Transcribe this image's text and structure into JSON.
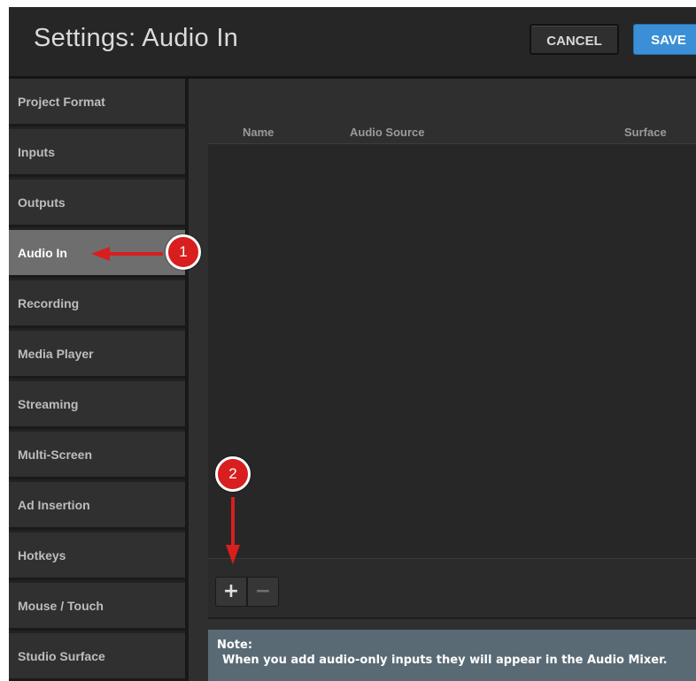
{
  "header": {
    "title": "Settings: Audio In",
    "cancel_label": "CANCEL",
    "save_label": "SAVE"
  },
  "sidebar": {
    "items": [
      {
        "label": "Project Format"
      },
      {
        "label": "Inputs"
      },
      {
        "label": "Outputs"
      },
      {
        "label": "Audio In",
        "active": true
      },
      {
        "label": "Recording"
      },
      {
        "label": "Media Player"
      },
      {
        "label": "Streaming"
      },
      {
        "label": "Multi-Screen"
      },
      {
        "label": "Ad Insertion"
      },
      {
        "label": "Hotkeys"
      },
      {
        "label": "Mouse / Touch"
      },
      {
        "label": "Studio Surface"
      }
    ]
  },
  "table": {
    "columns": [
      "Name",
      "Audio Source",
      "Surface"
    ],
    "rows": []
  },
  "toolbar": {
    "add_label": "+",
    "remove_label": "−"
  },
  "note": {
    "title": "Note:",
    "text": "When you add audio-only inputs they will appear in the Audio Mixer."
  },
  "callouts": [
    {
      "number": "1"
    },
    {
      "number": "2"
    }
  ],
  "colors": {
    "accent": "#3b8fd6",
    "callout": "#d81e1e",
    "active_item": "#6e6e6e",
    "note_bg": "#5a6a74"
  }
}
